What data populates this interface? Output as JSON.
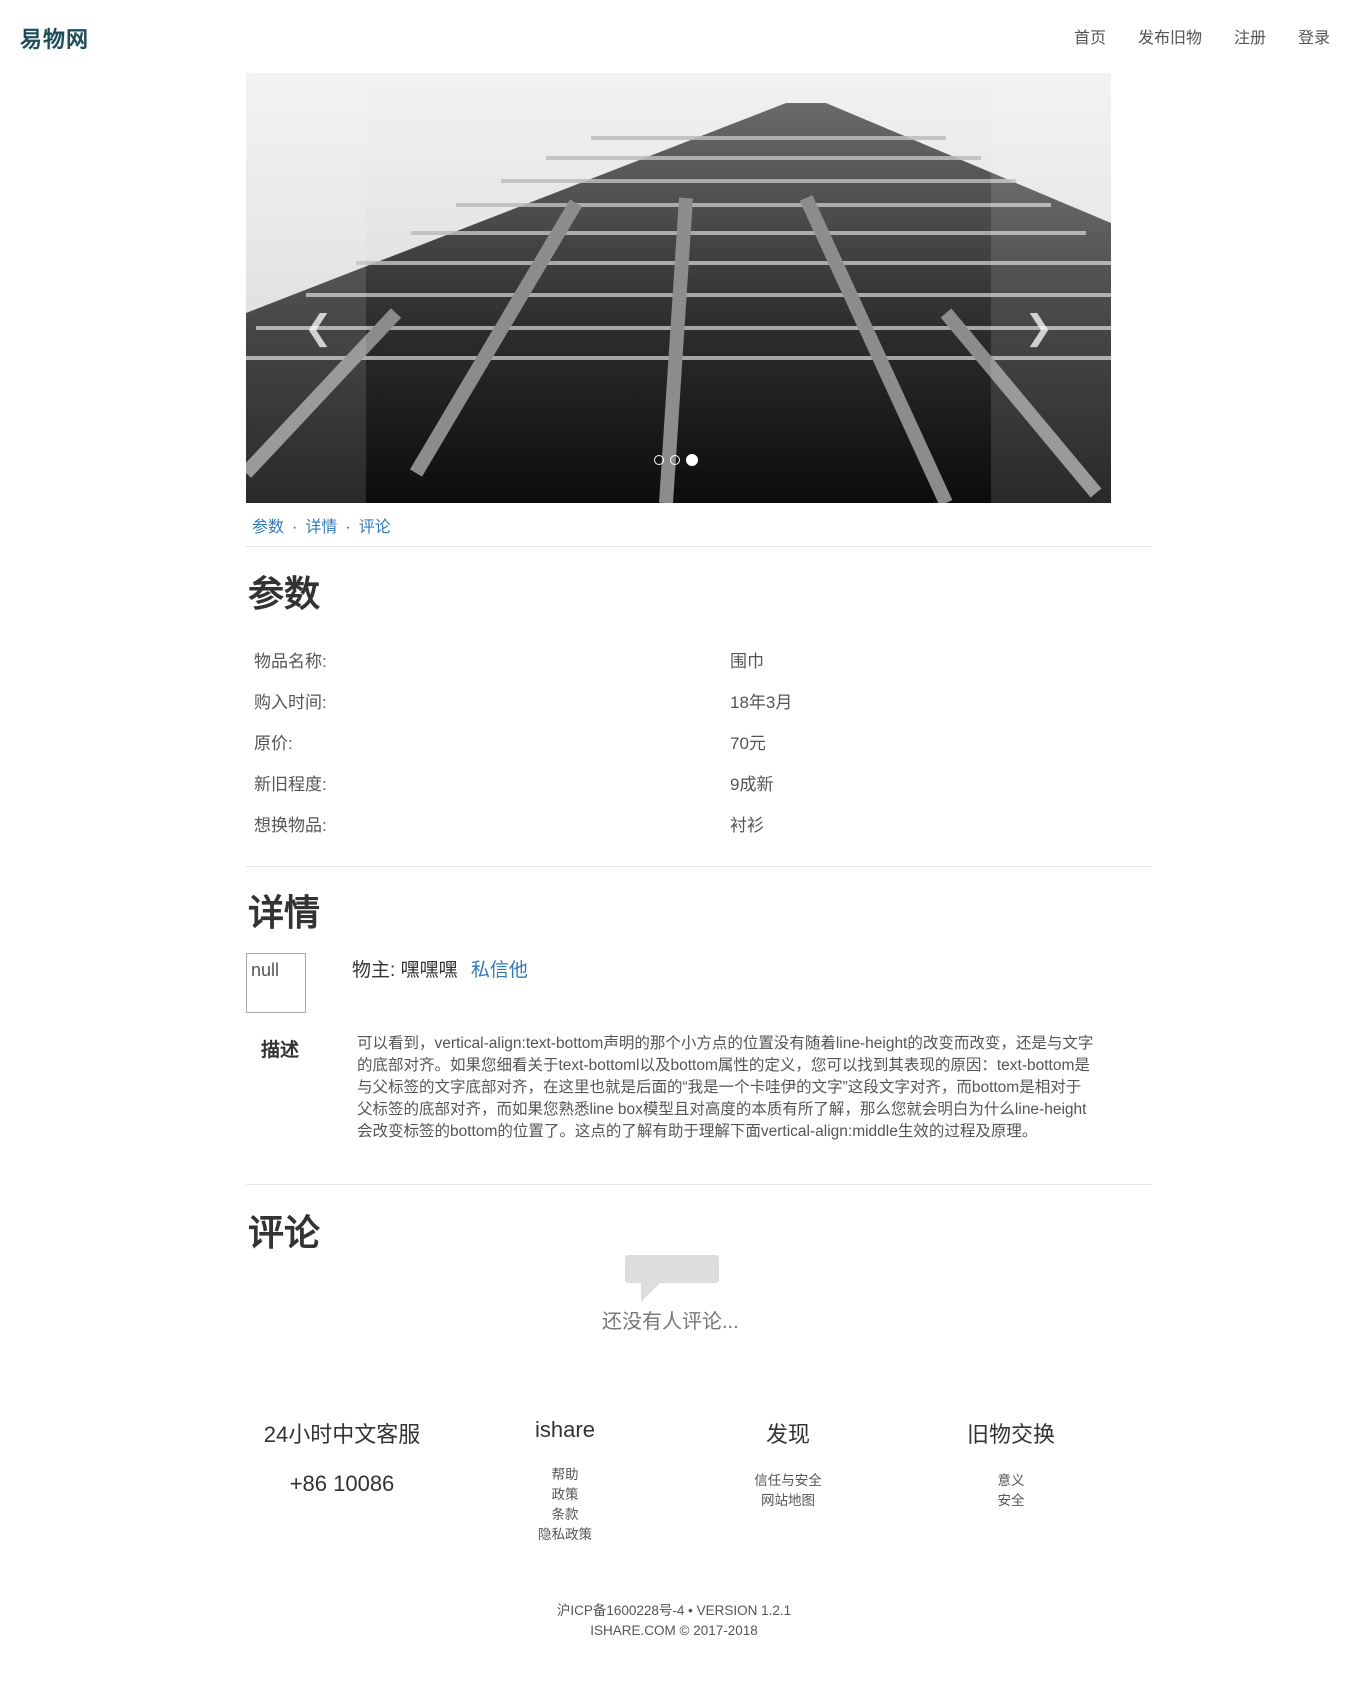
{
  "header": {
    "brand": "易物网",
    "nav": [
      "首页",
      "发布旧物",
      "注册",
      "登录"
    ]
  },
  "carousel": {
    "prev_icon": "chevron-left-icon",
    "next_icon": "chevron-right-icon",
    "slide_count": 3,
    "active_slide": 3
  },
  "anchors": [
    "参数",
    "详情",
    "评论"
  ],
  "params": {
    "title": "参数",
    "rows": [
      {
        "label": "物品名称:",
        "value": "围巾"
      },
      {
        "label": "购入时间:",
        "value": "18年3月"
      },
      {
        "label": "原价:",
        "value": "70元"
      },
      {
        "label": "新旧程度:",
        "value": "9成新"
      },
      {
        "label": "想换物品:",
        "value": "衬衫"
      }
    ]
  },
  "details": {
    "title": "详情",
    "avatar_alt": "null",
    "owner_label": "物主:",
    "owner_name": "嘿嘿嘿",
    "message_link": "私信他",
    "desc_label": "描述",
    "description": "可以看到，vertical-align:text-bottom声明的那个小方点的位置没有随着line-height的改变而改变，还是与文字的底部对齐。如果您细看关于text-bottoml以及bottom属性的定义，您可以找到其表现的原因：text-bottom是与父标签的文字底部对齐，在这里也就是后面的“我是一个卡哇伊的文字”这段文字对齐，而bottom是相对于父标签的底部对齐，而如果您熟悉line box模型且对高度的本质有所了解，那么您就会明白为什么line-height会改变标签的bottom的位置了。这点的了解有助于理解下面vertical-align:middle生效的过程及原理。"
  },
  "comments": {
    "title": "评论",
    "empty_icon": "speech-bubble-icon",
    "empty_text": "还没有人评论..."
  },
  "footer": {
    "columns": [
      {
        "title": "24小时中文客服",
        "big": "+86 10086",
        "links": []
      },
      {
        "title": "ishare",
        "big": "",
        "links": [
          "帮助",
          "政策",
          "条款",
          "隐私政策"
        ]
      },
      {
        "title": "发现",
        "big": "",
        "links": [
          "信任与安全",
          "网站地图"
        ]
      },
      {
        "title": "旧物交换",
        "big": "",
        "links": [
          "意义",
          "安全"
        ]
      }
    ],
    "icp": "沪ICP备1600228号-4 • VERSION 1.2.1",
    "copyright": "ISHARE.COM © 2017-2018"
  }
}
